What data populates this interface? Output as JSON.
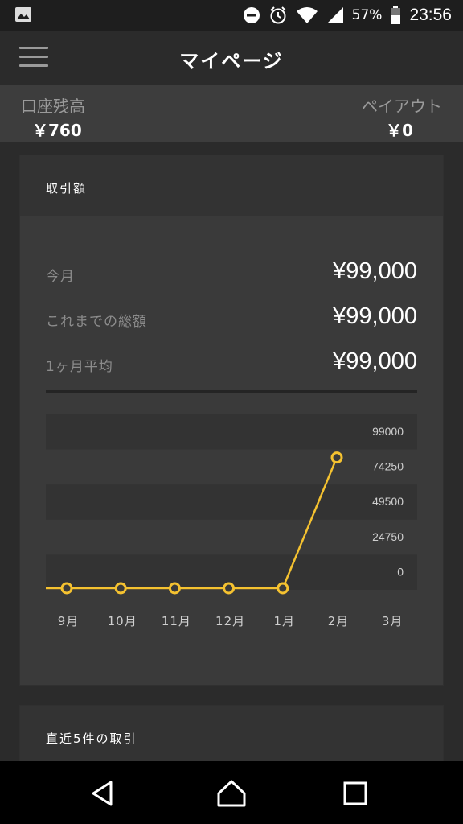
{
  "status_bar": {
    "icons": [
      "image-icon",
      "do-not-disturb-icon",
      "alarm-icon",
      "wifi-icon",
      "signal-icon",
      "battery-icon"
    ],
    "battery_percent": "57%",
    "time": "23:56"
  },
  "app_bar": {
    "menu_icon": "hamburger-menu-icon",
    "title": "マイページ"
  },
  "balance": {
    "left_label": "口座残高",
    "left_value": "￥760",
    "right_label": "ペイアウト",
    "right_value": "￥0"
  },
  "transactions_card": {
    "title": "取引額",
    "stats": [
      {
        "label": "今月",
        "value": "¥99,000"
      },
      {
        "label": "これまでの総額",
        "value": "¥99,000"
      },
      {
        "label": "1ヶ月平均",
        "value": "¥99,000"
      }
    ]
  },
  "chart_data": {
    "type": "line",
    "categories": [
      "9月",
      "10月",
      "11月",
      "12月",
      "1月",
      "2月",
      "3月"
    ],
    "series": [
      {
        "values": [
          0,
          0,
          0,
          0,
          0,
          82000,
          null
        ]
      }
    ],
    "ylim": [
      0,
      99000
    ],
    "yticks": [
      "99000",
      "74250",
      "49500",
      "24750",
      "0"
    ],
    "line_color": "#f5c230",
    "grid": "alternating bands",
    "title": "",
    "xlabel": "",
    "ylabel": ""
  },
  "recent_card": {
    "title": "直近5件の取引"
  },
  "nav_bar": {
    "icons": [
      "back-icon",
      "home-icon",
      "recents-icon"
    ]
  }
}
